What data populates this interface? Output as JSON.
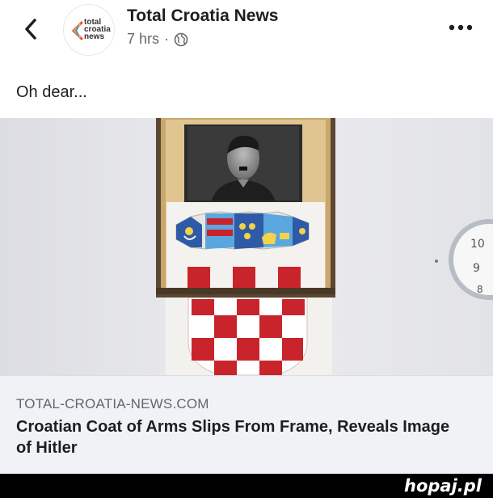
{
  "post": {
    "page_name": "Total Croatia News",
    "timestamp": "7 hrs",
    "separator": "·",
    "privacy_icon": "globe-icon",
    "text": "Oh dear...",
    "avatar_logo": [
      "total",
      "croatia",
      "news"
    ]
  },
  "nav": {
    "back_icon": "chevron-left-icon",
    "more_icon": "more-dots-icon"
  },
  "link": {
    "domain": "TOTAL-CROATIA-NEWS.COM",
    "title": "Croatian Coat of Arms Slips From Frame, Reveals Image of Hitler"
  },
  "watermark": {
    "text": "hopaj.pl"
  },
  "colors": {
    "name_text": "#1c1e21",
    "meta_text": "#65676b",
    "preview_bg": "#f0f2f5",
    "watermark_bg": "#000000"
  }
}
